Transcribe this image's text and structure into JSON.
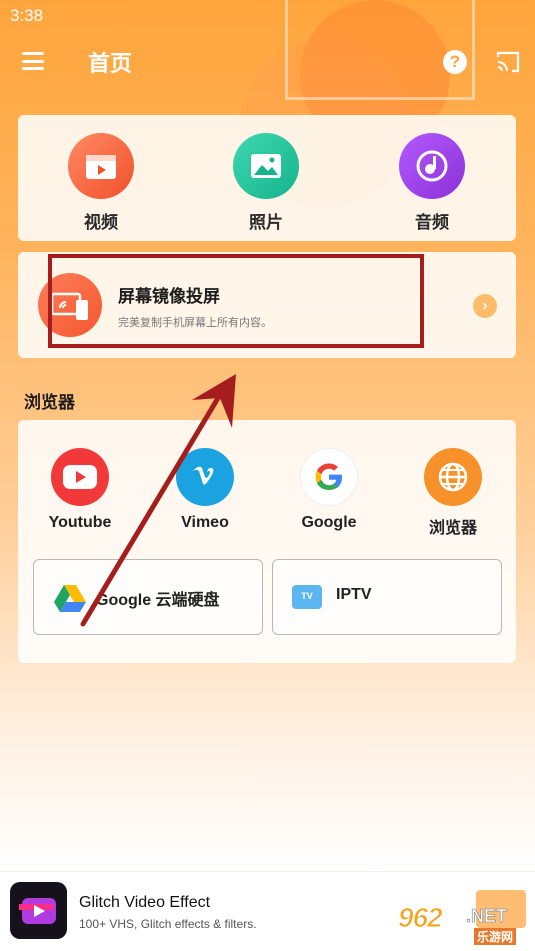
{
  "status_bar": {
    "time": "3:38"
  },
  "app_bar": {
    "title": "首页",
    "menu_icon": "menu-icon",
    "help_icon": "help-icon",
    "help_glyph": "?",
    "cast_icon": "cast-icon"
  },
  "media": [
    {
      "label": "视频",
      "icon": "video-icon",
      "color": "#f4572f"
    },
    {
      "label": "照片",
      "icon": "photo-icon",
      "color": "#1fbf98"
    },
    {
      "label": "音频",
      "icon": "music-icon",
      "color": "#9a3ee0"
    }
  ],
  "mirror": {
    "title": "屏幕镜像投屏",
    "description": "完美复制手机屏幕上所有内容。",
    "icon": "screen-mirror-icon",
    "arrow_glyph": "›"
  },
  "browser_section": {
    "title": "浏览器",
    "items": [
      {
        "label": "Youtube",
        "icon": "youtube-icon",
        "color": "#f2393a"
      },
      {
        "label": "Vimeo",
        "icon": "vimeo-icon",
        "color": "#1aa3e0"
      },
      {
        "label": "Google",
        "icon": "google-icon",
        "color": "#ffffff"
      },
      {
        "label": "浏览器",
        "icon": "globe-icon",
        "color": "#f7922b"
      }
    ],
    "buttons": [
      {
        "label": "Google 云端硬盘",
        "icon": "google-drive-icon"
      },
      {
        "label": "IPTV",
        "icon": "tv-icon"
      }
    ]
  },
  "ad": {
    "title": "Glitch Video Effect",
    "subtitle": "100+ VHS, Glitch effects & filters.",
    "icon": "glitch-app-icon"
  },
  "watermark": {
    "number": "962",
    "suffix": ".NET",
    "sub": "乐游网"
  },
  "colors": {
    "accent": "#ffa53c",
    "annotation_red": "#a51d1c"
  }
}
